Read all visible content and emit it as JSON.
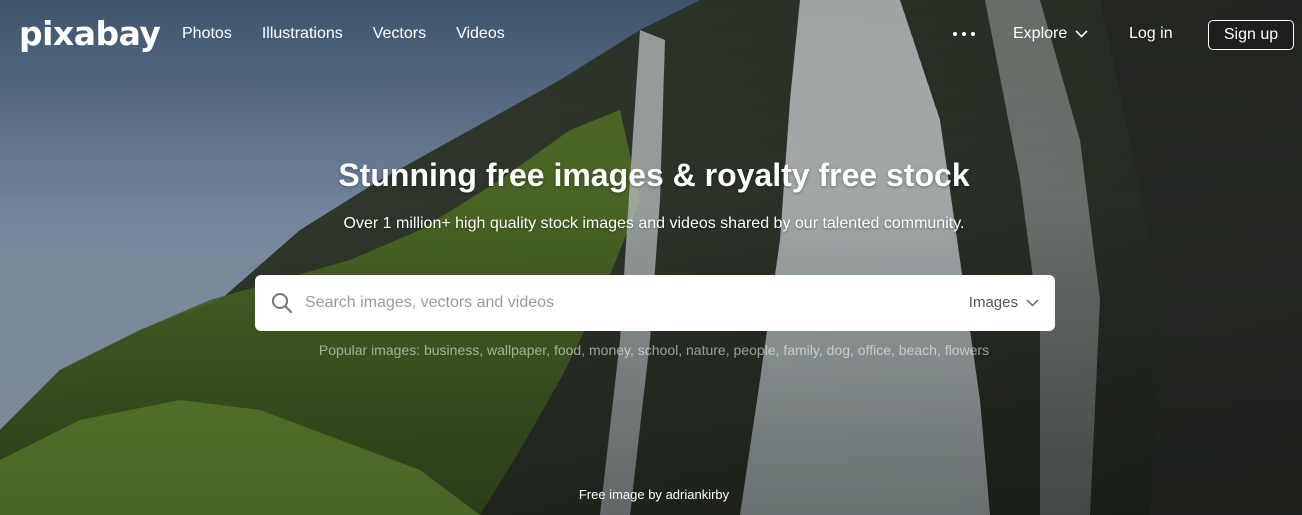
{
  "header": {
    "logo": "pixabay",
    "nav": [
      "Photos",
      "Illustrations",
      "Vectors",
      "Videos"
    ],
    "explore_label": "Explore",
    "login_label": "Log in",
    "signup_label": "Sign up"
  },
  "hero": {
    "title": "Stunning free images & royalty free stock",
    "subtitle": "Over 1 million+ high quality stock images and videos shared by our talented community."
  },
  "search": {
    "placeholder": "Search images, vectors and videos",
    "value": "",
    "type_selected": "Images"
  },
  "popular": {
    "label": "Popular images:",
    "tags": [
      "business",
      "wallpaper",
      "food",
      "money",
      "school",
      "nature",
      "people",
      "family",
      "dog",
      "office",
      "beach",
      "flowers"
    ]
  },
  "credit": {
    "prefix": "Free image by",
    "author": "adriankirby"
  },
  "icons": {
    "search": "search-icon",
    "more": "more-dots-icon",
    "chevron": "chevron-down-icon"
  }
}
